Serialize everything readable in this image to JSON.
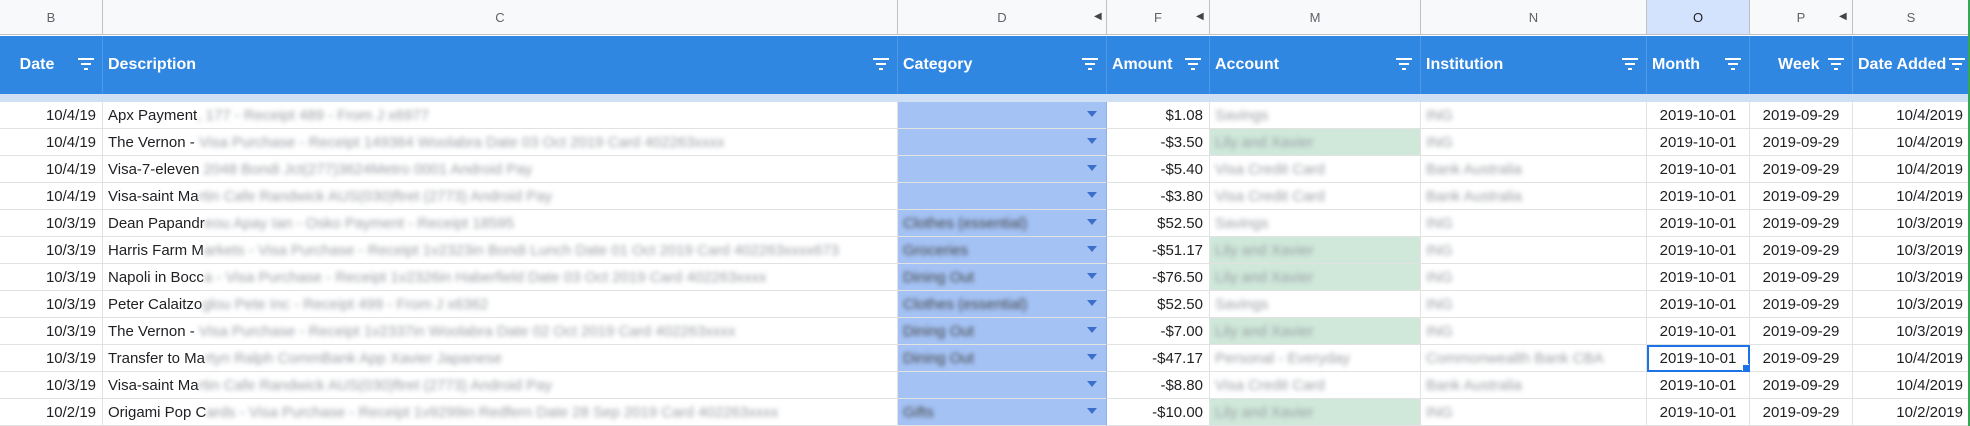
{
  "column_letters": [
    "B",
    "C",
    "D",
    "F",
    "M",
    "N",
    "O",
    "P",
    "S"
  ],
  "selected_column_letter": "O",
  "headers": {
    "date": "Date",
    "description": "Description",
    "category": "Category",
    "amount": "Amount",
    "account": "Account",
    "institution": "Institution",
    "month": "Month",
    "week": "Week",
    "date_added": "Date Added"
  },
  "rows": [
    {
      "date": "10/4/19",
      "desc": "Apx Payment",
      "desc_blur": ", 177 - Receipt 489 - From J x6977",
      "cat": "",
      "amount": "$1.08",
      "account": "Savings",
      "acct_tint": "none",
      "institution": "ING",
      "month": "2019-10-01",
      "week": "2019-09-29",
      "date_added": "10/4/2019"
    },
    {
      "date": "10/4/19",
      "desc": "The Vernon - ",
      "desc_blur": "Visa Purchase - Receipt 149364 Woolabra Date 03 Oct 2019 Card 402263xxxx",
      "cat": "",
      "amount": "-$3.50",
      "account": "Lily and Xavier",
      "acct_tint": "green",
      "institution": "ING",
      "month": "2019-10-01",
      "week": "2019-09-29",
      "date_added": "10/4/2019"
    },
    {
      "date": "10/4/19",
      "desc": "Visa-7-eleven",
      "desc_blur": " 2048 Bondi Jct(277)3624Metro 0001 Android Pay",
      "cat": "",
      "amount": "-$5.40",
      "account": "Visa Credit Card",
      "acct_tint": "none",
      "institution": "Bank Australia",
      "month": "2019-10-01",
      "week": "2019-09-29",
      "date_added": "10/4/2019"
    },
    {
      "date": "10/4/19",
      "desc": "Visa-saint Ma",
      "desc_blur": "rtin Cafe Randwick AUS(030)ftret (2773) Android Pay",
      "cat": "",
      "amount": "-$3.80",
      "account": "Visa Credit Card",
      "acct_tint": "none",
      "institution": "Bank Australia",
      "month": "2019-10-01",
      "week": "2019-09-29",
      "date_added": "10/4/2019"
    },
    {
      "date": "10/3/19",
      "desc": "Dean Papandr",
      "desc_blur": "eou Apay Ian - Osko Payment - Receipt 18595",
      "cat": "Clothes (essential)",
      "amount": "$52.50",
      "account": "Savings",
      "acct_tint": "none",
      "institution": "ING",
      "month": "2019-10-01",
      "week": "2019-09-29",
      "date_added": "10/3/2019"
    },
    {
      "date": "10/3/19",
      "desc": "Harris Farm M",
      "desc_blur": "arkets - Visa Purchase - Receipt 1v2323in Bondi Lunch Date 01 Oct 2019 Card 402263xxxx673",
      "cat": "Groceries",
      "amount": "-$51.17",
      "account": "Lily and Xavier",
      "acct_tint": "green",
      "institution": "ING",
      "month": "2019-10-01",
      "week": "2019-09-29",
      "date_added": "10/3/2019"
    },
    {
      "date": "10/3/19",
      "desc": "Napoli in Bocc",
      "desc_blur": "a - Visa Purchase - Receipt 1v2326in Haberfield Date 03 Oct 2019 Card 402263xxxx",
      "cat": "Dining Out",
      "amount": "-$76.50",
      "account": "Lily and Xavier",
      "acct_tint": "green",
      "institution": "ING",
      "month": "2019-10-01",
      "week": "2019-09-29",
      "date_added": "10/3/2019"
    },
    {
      "date": "10/3/19",
      "desc": "Peter Calaitzo",
      "desc_blur": "glou Pete Inc - Receipt 499 - From J x6362",
      "cat": "Clothes (essential)",
      "amount": "$52.50",
      "account": "Savings",
      "acct_tint": "none",
      "institution": "ING",
      "month": "2019-10-01",
      "week": "2019-09-29",
      "date_added": "10/3/2019"
    },
    {
      "date": "10/3/19",
      "desc": "The Vernon - ",
      "desc_blur": "Visa Purchase - Receipt 1v2337in Woolabra Date 02 Oct 2019 Card 402263xxxx",
      "cat": "Dining Out",
      "amount": "-$7.00",
      "account": "Lily and Xavier",
      "acct_tint": "green",
      "institution": "ING",
      "month": "2019-10-01",
      "week": "2019-09-29",
      "date_added": "10/3/2019"
    },
    {
      "date": "10/3/19",
      "desc": "Transfer to Ma",
      "desc_blur": "rtyn Ralph CommBank App Xavier Japanese",
      "cat": "Dining Out",
      "amount": "-$47.17",
      "account": "Personal - Everyday",
      "acct_tint": "white",
      "institution": "Commonwealth Bank CBA",
      "month": "2019-10-01",
      "week": "2019-09-29",
      "date_added": "10/4/2019",
      "active_month": true
    },
    {
      "date": "10/3/19",
      "desc": "Visa-saint Ma",
      "desc_blur": "rtin Cafe Randwick AUS(030)ftret (2773) Android Pay",
      "cat": "",
      "amount": "-$8.80",
      "account": "Visa Credit Card",
      "acct_tint": "none",
      "institution": "Bank Australia",
      "month": "2019-10-01",
      "week": "2019-09-29",
      "date_added": "10/4/2019"
    },
    {
      "date": "10/2/19",
      "desc": "Origami Pop C",
      "desc_blur": "ards - Visa Purchase - Receipt 1v9299in Redfern Date 28 Sep 2019 Card 402263xxxx",
      "cat": "Gifts",
      "amount": "-$10.00",
      "account": "Lily and Xavier",
      "acct_tint": "green",
      "institution": "ING",
      "month": "2019-10-01",
      "week": "2019-09-29",
      "date_added": "10/2/2019"
    }
  ]
}
